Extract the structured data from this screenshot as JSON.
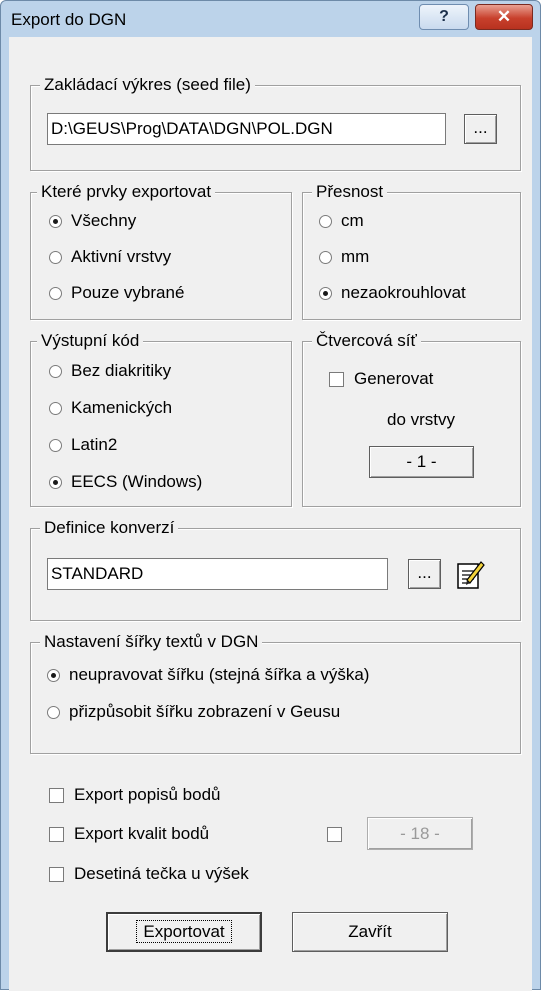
{
  "window": {
    "title": "Export do DGN",
    "help_label": "?",
    "close_label": "✕"
  },
  "seed": {
    "legend": "Zakládací výkres (seed file)",
    "path_value": "D:\\GEUS\\Prog\\DATA\\DGN\\POL.DGN",
    "browse_label": "..."
  },
  "elements": {
    "legend": "Které prvky exportovat",
    "options": [
      "Všechny",
      "Aktivní vrstvy",
      "Pouze vybrané"
    ],
    "selected": 0
  },
  "precision": {
    "legend": "Přesnost",
    "options": [
      "cm",
      "mm",
      "nezaokrouhlovat"
    ],
    "selected": 2
  },
  "output_code": {
    "legend": "Výstupní kód",
    "options": [
      "Bez diakritiky",
      "Kamenických",
      "Latin2",
      "EECS (Windows)"
    ],
    "selected": 3
  },
  "grid": {
    "legend": "Čtvercová síť",
    "generate_label": "Generovat",
    "layer_label": "do vrstvy",
    "layer_button": "- 1 -"
  },
  "conversion": {
    "legend": "Definice konverzí",
    "value": "STANDARD",
    "browse_label": "...",
    "edit_icon": "edit-document-icon"
  },
  "text_width": {
    "legend": "Nastavení šířky textů v DGN",
    "options": [
      "neupravovat šířku (stejná šířka a výška)",
      "přizpůsobit šířku zobrazení v Geusu"
    ],
    "selected": 0
  },
  "options": {
    "export_labels": "Export popisů bodů",
    "export_quality": "Export kvalit bodů",
    "quality_layer_button": "- 18 -",
    "decimal_point": "Desetiná tečka u výšek"
  },
  "buttons": {
    "export": "Exportovat",
    "close": "Zavřít"
  }
}
